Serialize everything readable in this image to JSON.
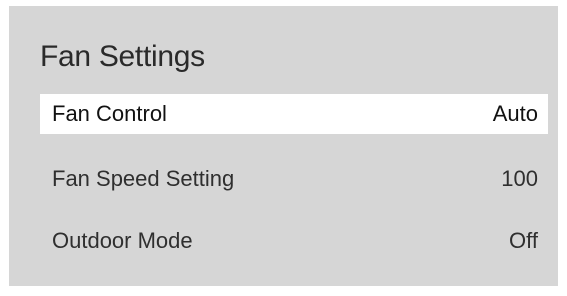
{
  "panel": {
    "title": "Fan Settings",
    "items": [
      {
        "label": "Fan Control",
        "value": "Auto",
        "selected": true
      },
      {
        "label": "Fan Speed Setting",
        "value": "100",
        "selected": false
      },
      {
        "label": "Outdoor Mode",
        "value": "Off",
        "selected": false
      }
    ]
  },
  "colors": {
    "panel_background": "#d6d6d6",
    "selected_background": "#ffffff"
  }
}
